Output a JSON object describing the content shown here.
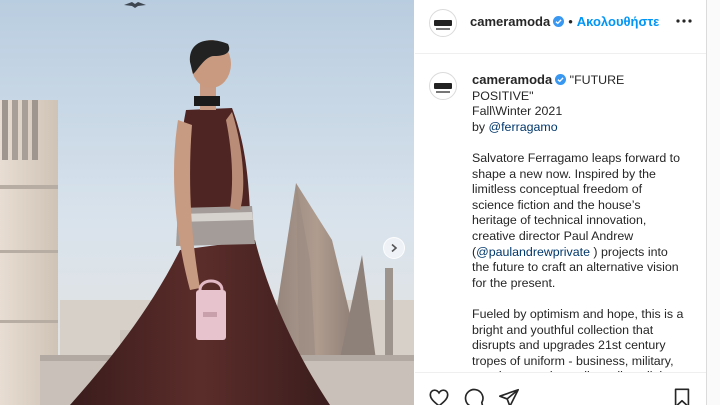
{
  "post": {
    "author": {
      "username": "cameramoda",
      "verified": true,
      "avatar_icon": "camera-moda-logo-icon"
    },
    "header": {
      "separator": "•",
      "follow_label": "Ακολουθήστε",
      "more_icon": "more-horizontal-icon"
    },
    "caption": {
      "username": "cameramoda",
      "line1": "\"FUTURE POSITIVE\"",
      "line2": "Fall\\Winter 2021",
      "line3_prefix": "by ",
      "line3_mention": "@ferragamo",
      "para2_a": "Salvatore Ferragamo leaps forward to shape a new now. Inspired by the limitless conceptual freedom of science fiction and the house’s heritage of technical innovation, creative director Paul Andrew (",
      "para2_mention": "@paulandrewprivate",
      "para2_b": " ) projects into the future to craft an alternative vision for the present.",
      "para3": "Fueled by optimism and hope, this is a bright and youthful collection that disrupts and upgrades 21st century tropes of uniform - business, military, evening, sporting – discarding all that is old-fashioned."
    },
    "media": {
      "next_icon": "chevron-right-icon"
    },
    "actions": {
      "icons": [
        "heart-icon",
        "comment-icon",
        "share-icon",
        "bookmark-icon"
      ]
    },
    "colors": {
      "link": "#0095f6",
      "mention": "#00376b",
      "verified": "#3897f0"
    }
  }
}
